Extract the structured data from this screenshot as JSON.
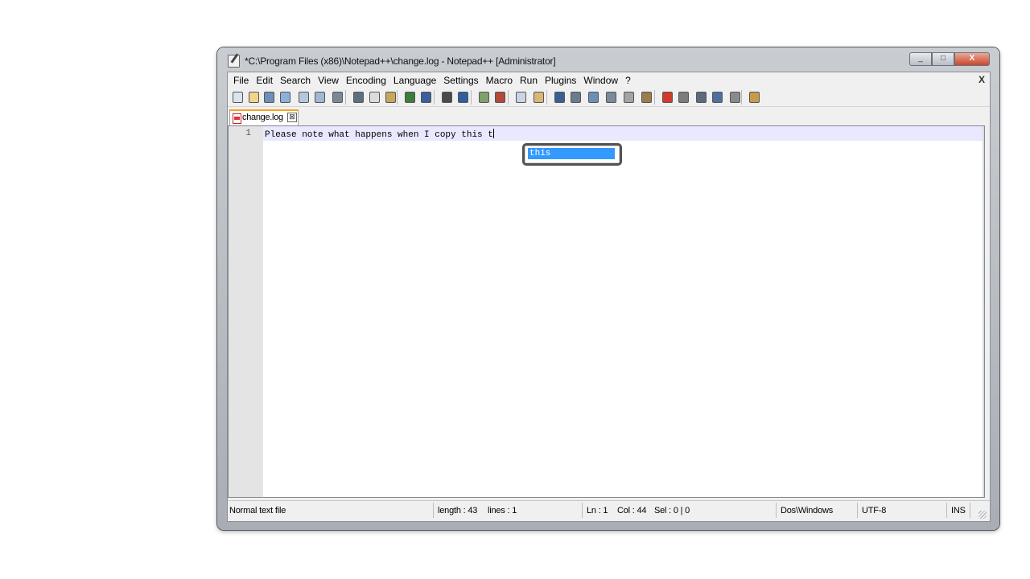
{
  "window": {
    "title": "*C:\\Program Files (x86)\\Notepad++\\change.log - Notepad++ [Administrator]",
    "minimize_label": "_",
    "maximize_label": "□",
    "close_label": "X"
  },
  "menu": {
    "items": [
      "File",
      "Edit",
      "Search",
      "View",
      "Encoding",
      "Language",
      "Settings",
      "Macro",
      "Run",
      "Plugins",
      "Window",
      "?"
    ],
    "close_label": "X"
  },
  "toolbar": {
    "icons": [
      "new-file-icon",
      "open-file-icon",
      "save-icon",
      "save-all-icon",
      "close-icon",
      "close-all-icon",
      "print-icon",
      "cut-icon",
      "copy-icon",
      "paste-icon",
      "undo-icon",
      "redo-icon",
      "find-icon",
      "replace-icon",
      "zoom-in-icon",
      "zoom-out-icon",
      "sync-vertical-icon",
      "sync-horizontal-icon",
      "word-wrap-icon",
      "show-all-chars-icon",
      "indent-guide-icon",
      "document-map-icon",
      "function-list-icon",
      "folder-workspace-icon",
      "record-macro-icon",
      "stop-macro-icon",
      "play-macro-icon",
      "run-macro-multiple-icon",
      "save-macro-icon",
      "launch-browser-icon"
    ]
  },
  "tab": {
    "label": "change.log",
    "close_label": "⊠"
  },
  "editor": {
    "line_number": "1",
    "line_text": "Please note what happens when I copy this t",
    "autocomplete_option": "this"
  },
  "status": {
    "file_type": "Normal text file",
    "length": "length : 43",
    "lines": "lines : 1",
    "ln": "Ln : 1",
    "col": "Col : 44",
    "sel": "Sel : 0 | 0",
    "eol": "Dos\\Windows",
    "encoding": "UTF-8",
    "mode": "INS"
  },
  "colors": {
    "accent": "#3399ff",
    "current_line": "#e8e8ff",
    "tab_highlight": "#f7a326"
  }
}
